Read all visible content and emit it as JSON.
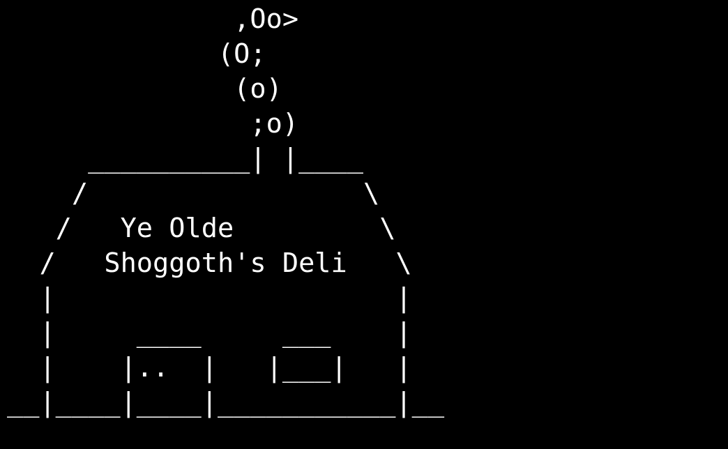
{
  "colors": {
    "background": "#000000",
    "text": "#ffffff"
  },
  "ascii_art": {
    "lines": [
      "              ,Oo>",
      "             (O;",
      "              (o)",
      "               ;o)",
      "     __________| |____",
      "    /                 \\",
      "   /   Ye Olde         \\",
      "  /   Shoggoth's Deli   \\",
      "  |                     |",
      "  |     ____     ___    |",
      "  |    |..  |   |___|   |",
      "__|____|____|___________|__"
    ]
  }
}
